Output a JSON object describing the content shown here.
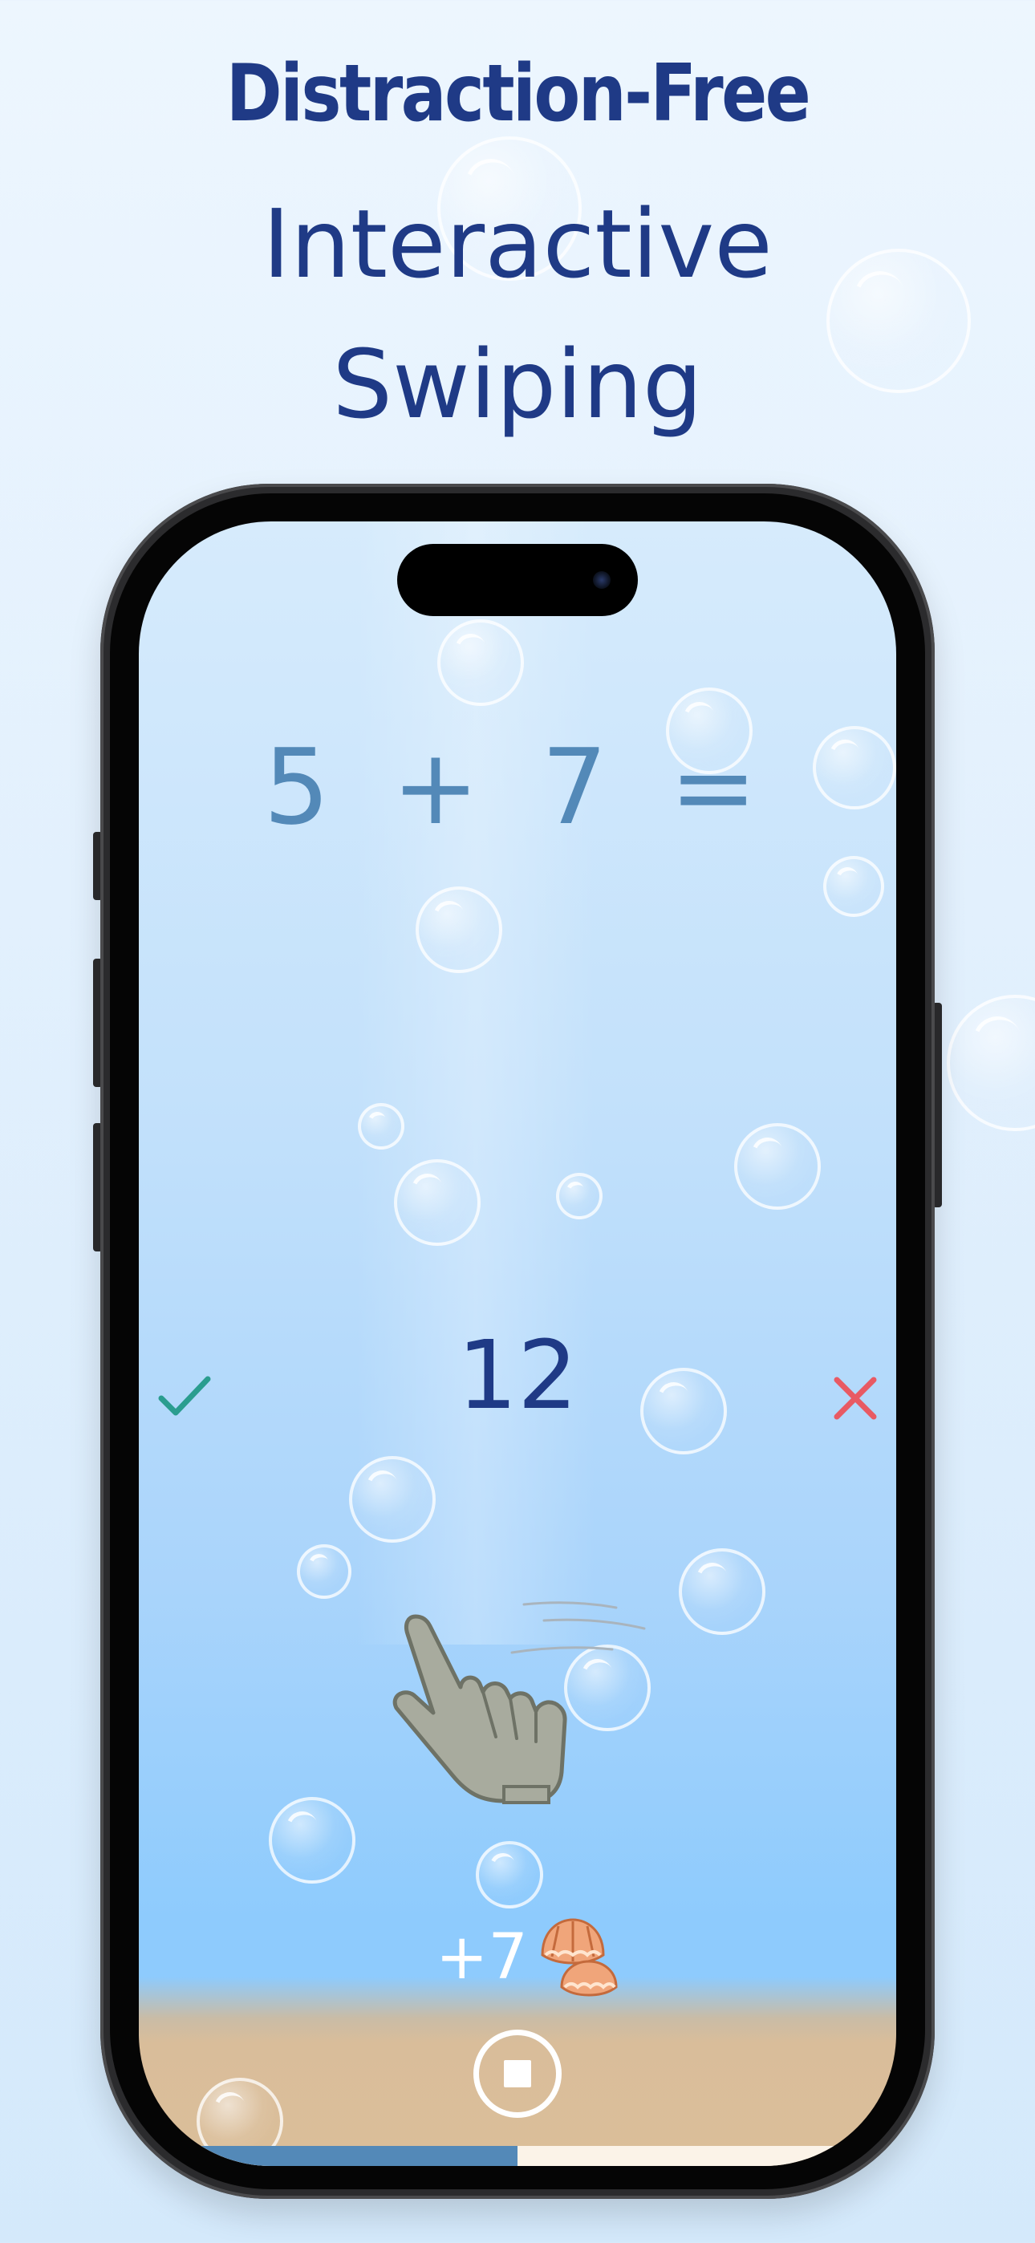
{
  "headline": {
    "line1": "Distraction-Free",
    "line2": "Interactive",
    "line3": "Swiping"
  },
  "game": {
    "equation": "5 + 7 =",
    "answer": "12",
    "correct_icon": "checkmark-icon",
    "wrong_icon": "cross-icon",
    "gesture_icon": "swipe-hand-icon",
    "reward_text": "+7",
    "reward_icon": "shell-icon",
    "stop_icon": "stop-icon",
    "progress_fraction": 0.5
  },
  "colors": {
    "headline": "#1f3a86",
    "equation": "#5389b8",
    "answer": "#1f3a86",
    "correct": "#2a9d8f",
    "wrong": "#e85a64",
    "progress_fill": "#5389b8",
    "sand": "#dbbe99"
  }
}
